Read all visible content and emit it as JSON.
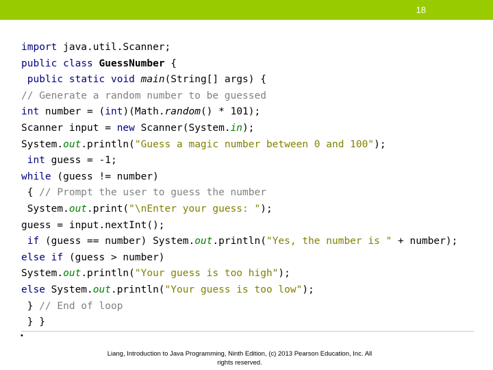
{
  "header": {
    "page_number": "18",
    "bar_color": "#99cc00"
  },
  "code": {
    "lines": [
      [
        {
          "t": "import",
          "c": "kw"
        },
        {
          "t": " java.util.Scanner;",
          "c": ""
        }
      ],
      [
        {
          "t": "public",
          "c": "kw"
        },
        {
          "t": " ",
          "c": ""
        },
        {
          "t": "class",
          "c": "kw"
        },
        {
          "t": " ",
          "c": ""
        },
        {
          "t": "GuessNumber",
          "c": "cls"
        },
        {
          "t": " {",
          "c": ""
        }
      ],
      [
        {
          "t": " ",
          "c": ""
        },
        {
          "t": "public",
          "c": "kw"
        },
        {
          "t": " ",
          "c": ""
        },
        {
          "t": "static",
          "c": "kw"
        },
        {
          "t": " ",
          "c": ""
        },
        {
          "t": "void",
          "c": "kw"
        },
        {
          "t": " ",
          "c": ""
        },
        {
          "t": "main",
          "c": "mth"
        },
        {
          "t": "(String[] args) {",
          "c": ""
        }
      ],
      [
        {
          "t": "// Generate a random number to be guessed",
          "c": "com"
        }
      ],
      [
        {
          "t": "int",
          "c": "kw"
        },
        {
          "t": " number = (",
          "c": ""
        },
        {
          "t": "int",
          "c": "kw"
        },
        {
          "t": ")(Math.",
          "c": ""
        },
        {
          "t": "random",
          "c": "mth"
        },
        {
          "t": "() * 101);",
          "c": ""
        }
      ],
      [
        {
          "t": "Scanner input = ",
          "c": ""
        },
        {
          "t": "new",
          "c": "kw"
        },
        {
          "t": " Scanner(System.",
          "c": ""
        },
        {
          "t": "in",
          "c": "fld"
        },
        {
          "t": ");",
          "c": ""
        }
      ],
      [
        {
          "t": "System.",
          "c": ""
        },
        {
          "t": "out",
          "c": "fld"
        },
        {
          "t": ".println(",
          "c": ""
        },
        {
          "t": "\"Guess a magic number between 0 and 100\"",
          "c": "str"
        },
        {
          "t": ");",
          "c": ""
        }
      ],
      [
        {
          "t": " ",
          "c": ""
        },
        {
          "t": "int",
          "c": "kw"
        },
        {
          "t": " guess = -1;",
          "c": ""
        }
      ],
      [
        {
          "t": "while",
          "c": "kw"
        },
        {
          "t": " (guess != number)",
          "c": ""
        }
      ],
      [
        {
          "t": " { ",
          "c": ""
        },
        {
          "t": "// Prompt the user to guess the number",
          "c": "com"
        }
      ],
      [
        {
          "t": " System.",
          "c": ""
        },
        {
          "t": "out",
          "c": "fld"
        },
        {
          "t": ".print(",
          "c": ""
        },
        {
          "t": "\"\\nEnter your guess: \"",
          "c": "str"
        },
        {
          "t": ");",
          "c": ""
        }
      ],
      [
        {
          "t": "guess = input.nextInt();",
          "c": ""
        }
      ],
      [
        {
          "t": " ",
          "c": ""
        },
        {
          "t": "if",
          "c": "kw"
        },
        {
          "t": " (guess == number) System.",
          "c": ""
        },
        {
          "t": "out",
          "c": "fld"
        },
        {
          "t": ".println(",
          "c": ""
        },
        {
          "t": "\"Yes, the number is \"",
          "c": "str"
        },
        {
          "t": " + number);",
          "c": ""
        }
      ],
      [
        {
          "t": "else",
          "c": "kw"
        },
        {
          "t": " ",
          "c": ""
        },
        {
          "t": "if",
          "c": "kw"
        },
        {
          "t": " (guess > number)",
          "c": ""
        }
      ],
      [
        {
          "t": "System.",
          "c": ""
        },
        {
          "t": "out",
          "c": "fld"
        },
        {
          "t": ".println(",
          "c": ""
        },
        {
          "t": "\"Your guess is too high\"",
          "c": "str"
        },
        {
          "t": ");",
          "c": ""
        }
      ],
      [
        {
          "t": "else",
          "c": "kw"
        },
        {
          "t": " System.",
          "c": ""
        },
        {
          "t": "out",
          "c": "fld"
        },
        {
          "t": ".println(",
          "c": ""
        },
        {
          "t": "\"Your guess is too low\"",
          "c": "str"
        },
        {
          "t": ");",
          "c": ""
        }
      ],
      [
        {
          "t": " } ",
          "c": ""
        },
        {
          "t": "// End of loop",
          "c": "com"
        }
      ],
      [
        {
          "t": " } }",
          "c": ""
        }
      ]
    ]
  },
  "footer": {
    "line1": "Liang, Introduction to Java Programming, Ninth Edition, (c) 2013 Pearson Education, Inc. All",
    "line2": "rights reserved."
  }
}
